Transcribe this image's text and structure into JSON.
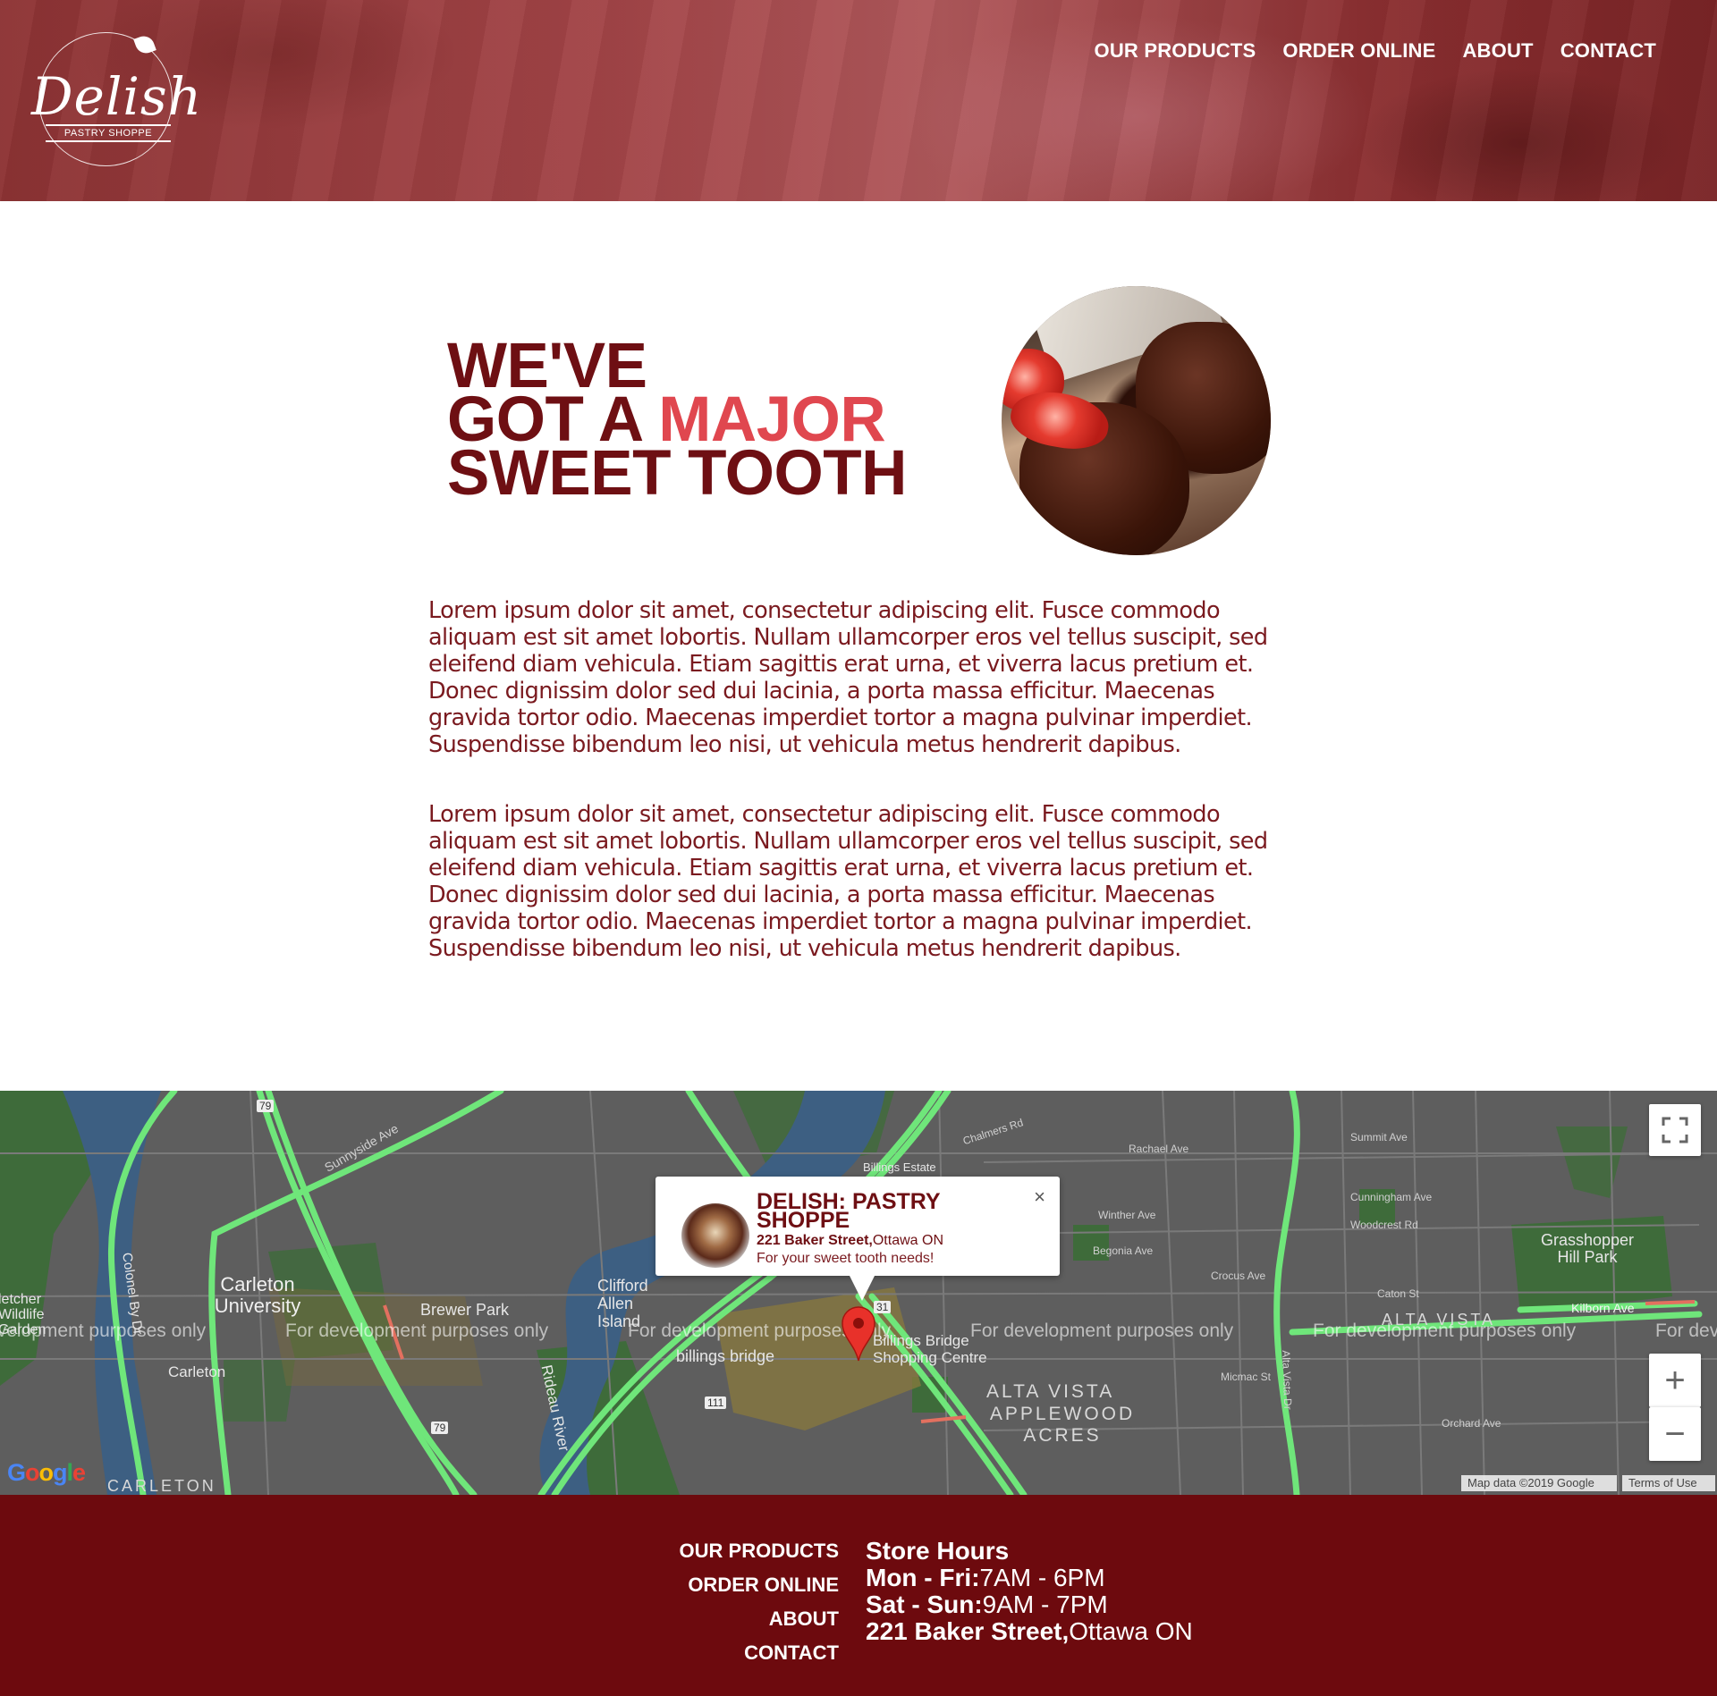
{
  "header": {
    "logo_word": "Delish",
    "logo_sub": "PASTRY SHOPPE",
    "nav": [
      "OUR PRODUCTS",
      "ORDER ONLINE",
      "ABOUT",
      "CONTACT"
    ]
  },
  "hero": {
    "line1": "WE'VE",
    "line2_prefix": "GOT A ",
    "line2_highlight": "MAJOR",
    "line3": "SWEET TOOTH"
  },
  "body": {
    "paragraphs": [
      "Lorem ipsum dolor sit amet, consectetur adipiscing elit. Fusce commodo aliquam est sit amet lobortis. Nullam ullamcorper eros vel tellus suscipit, sed eleifend diam vehicula. Etiam sagittis erat urna, et viverra lacus pretium et. Donec dignissim dolor sed dui lacinia, a porta massa efficitur. Maecenas gravida tortor odio. Maecenas imperdiet tortor a magna pulvinar imperdiet. Suspendisse bibendum leo nisi, ut vehicula metus hendrerit dapibus.",
      "Lorem ipsum dolor sit amet, consectetur adipiscing elit. Fusce commodo aliquam est sit amet lobortis. Nullam ullamcorper eros vel tellus suscipit, sed eleifend diam vehicula. Etiam sagittis erat urna, et viverra lacus pretium et. Donec dignissim dolor sed dui lacinia, a porta massa efficitur. Maecenas gravida tortor odio. Maecenas imperdiet tortor a magna pulvinar imperdiet. Suspendisse bibendum leo nisi, ut vehicula metus hendrerit dapibus."
    ]
  },
  "map": {
    "watermark": "For development purposes only",
    "popup": {
      "title": "DELISH: PASTRY SHOPPE",
      "address_bold": "221 Baker Street,",
      "address_rest": "Ottawa ON",
      "note": "For your sweet tooth needs!",
      "close": "×"
    },
    "labels": {
      "carleton_university": "Carleton University",
      "carleton": "Carleton",
      "carleton_area": "CARLETON",
      "brewer_park": "Brewer Park",
      "clifford_allen": "Clifford Allen Island",
      "billings_bridge": "billings bridge",
      "billings_bridge_shopping": "Billings Bridge Shopping Centre",
      "billings_estate": "Billings Estate",
      "alta_vista": "ALTA VISTA",
      "applewood_acres": "APPLEWOOD ACRES",
      "grasshopper_hill": "Grasshopper Hill Park",
      "alta_vista_upper": "ALTA VISTA",
      "fletcher": "letcher Wildlife Garden",
      "rideau_river": "Rideau River",
      "colonel_by": "Colonel By Dr",
      "sunnyside": "Sunnyside Ave",
      "kilborn": "Kilborn Ave",
      "alta_vista_dr": "Alta Vista Dr",
      "chalmers": "Chalmers Rd",
      "rachael": "Rachael Ave",
      "summit": "Summit Ave",
      "cunningham": "Cunningham Ave",
      "woodcrest": "Woodcrest Rd",
      "crocus": "Crocus Ave",
      "micmac": "Micmac St",
      "orchard": "Orchard Ave",
      "winther": "Winther Ave",
      "begonia": "Begonia Ave",
      "caton": "Caton St",
      "road_79": "79",
      "road_31": "31",
      "road_111": "111"
    },
    "controls": {
      "fullscreen": "fullscreen-icon",
      "zoom_in": "+",
      "zoom_out": "−"
    },
    "google": "Google",
    "credit_data": "Map data ©2019 Google",
    "credit_terms": "Terms of Use"
  },
  "footer": {
    "nav": [
      "OUR PRODUCTS",
      "ORDER ONLINE",
      "ABOUT",
      "CONTACT"
    ],
    "hours_title": "Store Hours",
    "weekday_label": "Mon - Fri:",
    "weekday_hours": "7AM - 6PM",
    "weekend_label": "Sat - Sun:",
    "weekend_hours": "9AM - 7PM",
    "address_bold": "221 Baker Street,",
    "address_rest": "Ottawa ON"
  },
  "colors": {
    "brand_dark": "#6e0f13",
    "brand_accent": "#e0474f",
    "footer_bg": "#6d0a0e"
  }
}
